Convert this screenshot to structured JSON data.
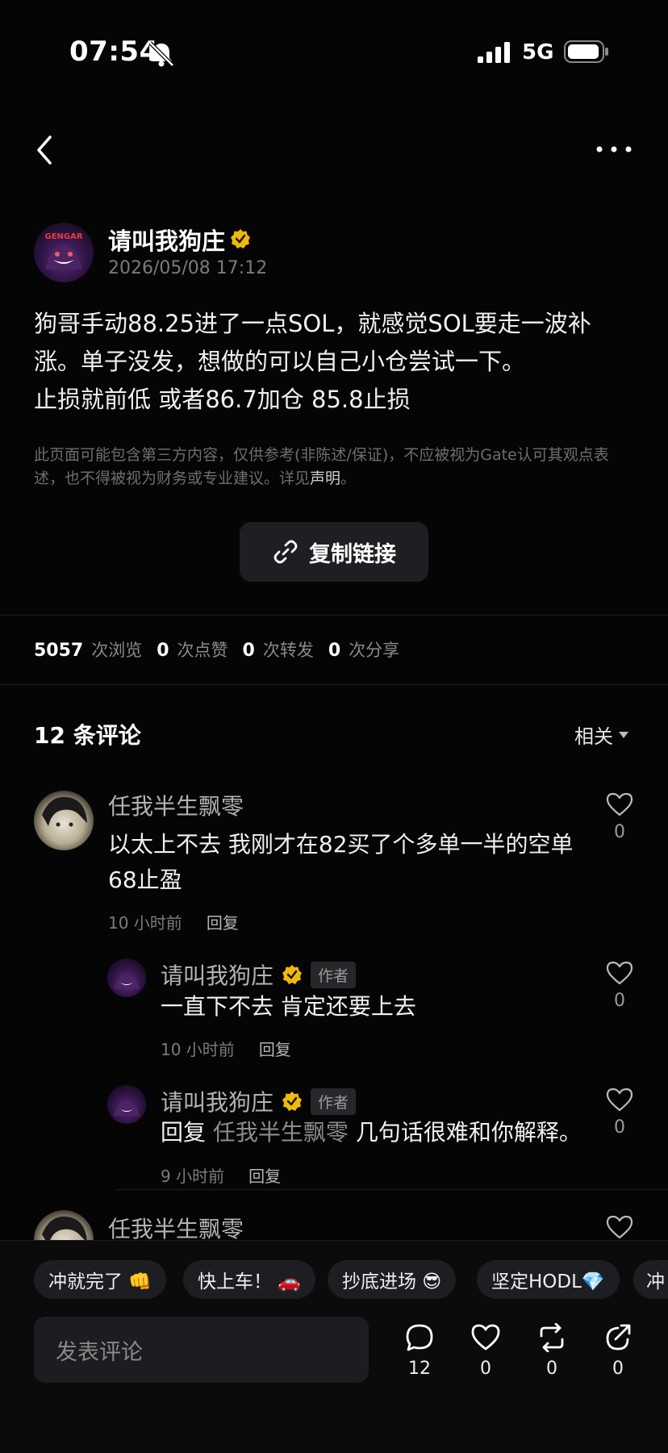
{
  "status_bar": {
    "time": "07:54",
    "network": "5G"
  },
  "post": {
    "author": "请叫我狗庄",
    "avatar_text": "GENGAR",
    "timestamp": "2026/05/08 17:12",
    "text": "狗哥手动88.25进了一点SOL，就感觉SOL要走一波补涨。单子没发，想做的可以自己小仓尝试一下。\n止损就前低 或者86.7加仓 85.8止损",
    "disclaimer": "此页面可能包含第三方内容，仅供参考(非陈述/保证)，不应被视为Gate认可其观点表述，也不得被视为财务或专业建议。详见",
    "disclaimer_link": "声明",
    "disclaimer_end": "。",
    "copy_link_label": "复制链接"
  },
  "stats": {
    "views": "5057",
    "views_label": "次浏览",
    "likes": "0",
    "likes_label": "次点赞",
    "reposts": "0",
    "reposts_label": "次转发",
    "shares": "0",
    "shares_label": "次分享"
  },
  "comments_header": {
    "title": "12 条评论",
    "sort": "相关"
  },
  "comments": [
    {
      "name": "任我半生飘零",
      "text": "以太上不去 我刚才在82买了个多单一半的空单68止盈",
      "time": "10 小时前",
      "reply_label": "回复",
      "likes": "0"
    },
    {
      "name": "请叫我狗庄",
      "tag": "作者",
      "text": "一直下不去 肯定还要上去",
      "time": "10 小时前",
      "reply_label": "回复",
      "likes": "0"
    },
    {
      "name": "请叫我狗庄",
      "tag": "作者",
      "reply_prefix": "回复",
      "mention": "任我半生飘零",
      "text": "几句话很难和你解释。",
      "time": "9 小时前",
      "reply_label": "回复",
      "likes": "0"
    },
    {
      "name": "任我半生飘零"
    }
  ],
  "quick_replies": [
    "冲就完了 👊",
    "快上车！ 🚗",
    "抄底进场 😎",
    "坚定HODL💎",
    "冲"
  ],
  "composer": {
    "placeholder": "发表评论",
    "comment_count": "12",
    "like_count": "0",
    "repost_count": "0",
    "share_count": "0"
  },
  "colors": {
    "verified": "#f0b90b",
    "background": "#050505"
  }
}
